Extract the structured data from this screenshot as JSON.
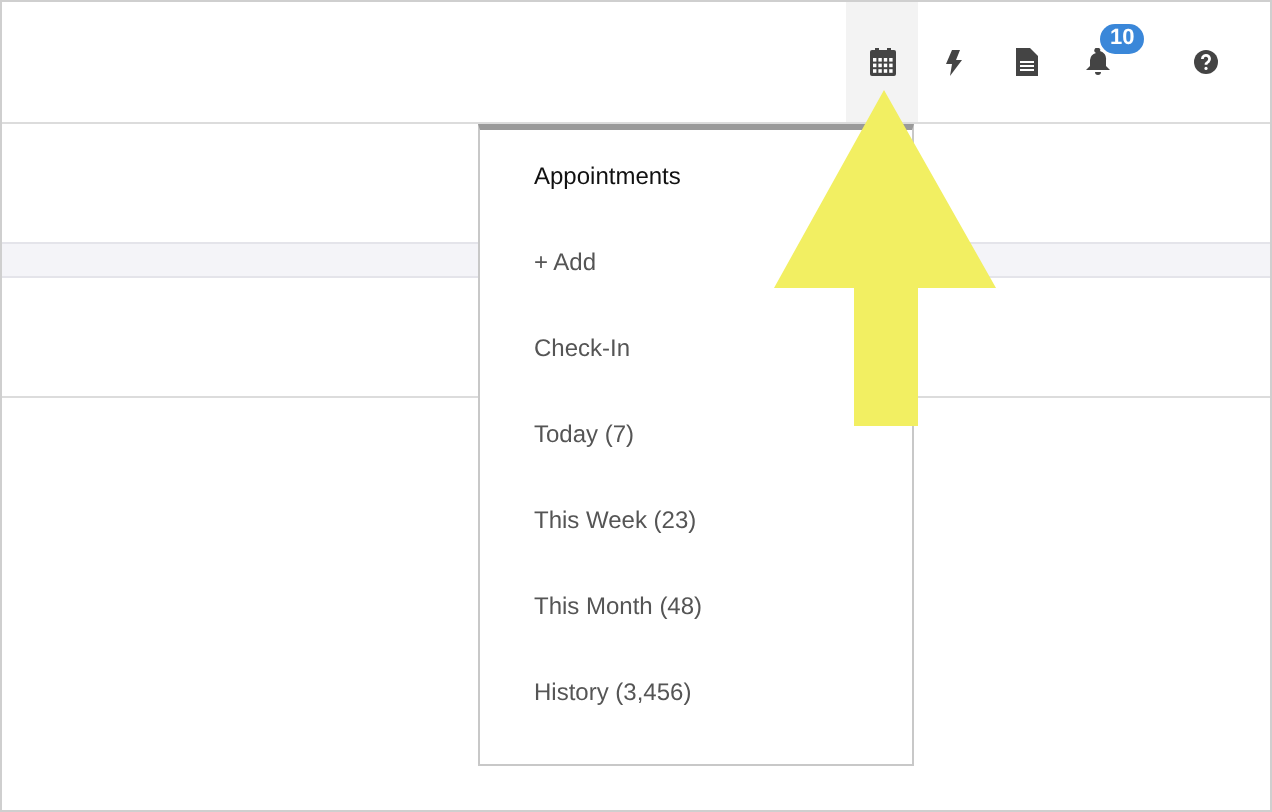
{
  "toolbar": [
    {
      "kind": "calendar",
      "selected": true
    },
    {
      "kind": "bolt",
      "selected": false
    },
    {
      "kind": "document",
      "selected": false
    },
    {
      "kind": "bell",
      "selected": false,
      "badge": "10"
    },
    {
      "kind": "help",
      "selected": false
    }
  ],
  "menu": {
    "title": "Appointments",
    "items": [
      "+ Add",
      "Check-In",
      "Today (7)",
      "This Week (23)",
      "This Month (48)",
      "History (3,456)"
    ]
  }
}
